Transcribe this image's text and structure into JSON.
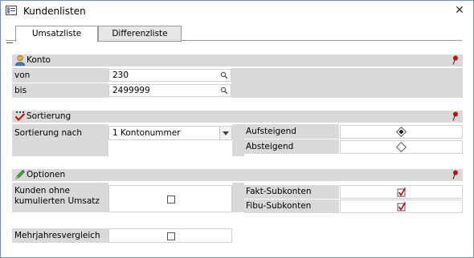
{
  "window": {
    "title": "Kundenlisten",
    "close_glyph": "✕"
  },
  "tabs": [
    {
      "label": "Umsatzliste",
      "active": true
    },
    {
      "label": "Differenzliste",
      "active": false
    }
  ],
  "konto": {
    "title": "Konto",
    "icon": "user-icon",
    "von_label": "von",
    "von_value": "230",
    "bis_label": "bis",
    "bis_value": "2499999"
  },
  "sortierung": {
    "title": "Sortierung",
    "icon": "checkmark-icon",
    "sort_label": "Sortierung nach",
    "sort_value": "1 Kontonummer",
    "asc_label": "Aufsteigend",
    "desc_label": "Absteigend",
    "asc_selected": true
  },
  "optionen": {
    "title": "Optionen",
    "icon": "pencil-icon",
    "kunden_label_line1": "Kunden ohne",
    "kunden_label_line2": "kumulierten Umsatz",
    "kunden_checked": false,
    "fakt_label": "Fakt-Subkonten",
    "fakt_checked": true,
    "fibu_label": "Fibu-Subkonten",
    "fibu_checked": true,
    "mehrjahr_label": "Mehrjahresvergleich",
    "mehrjahr_checked": false
  },
  "colors": {
    "header_bg": "#d9d9d9",
    "check_red": "#cc0000",
    "pin_red": "#cc0000"
  }
}
